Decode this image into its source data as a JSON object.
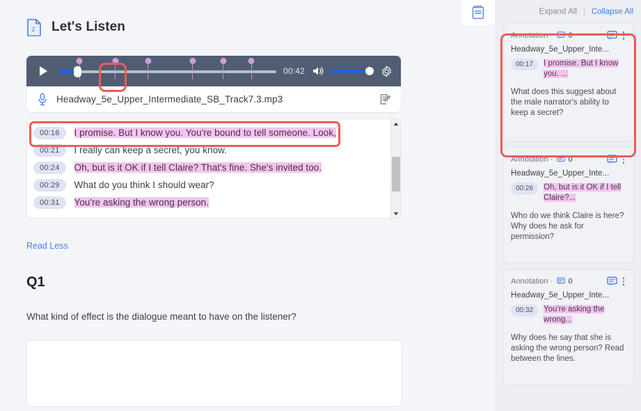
{
  "section": {
    "title": "Let's Listen",
    "doc_badge": "2"
  },
  "player": {
    "play_label": "play",
    "current_time_display": "00:42",
    "progress_percent": 8.5,
    "volume_percent": 100,
    "markers_percent": [
      9.5,
      26.0,
      41.0,
      61.5,
      75.5,
      88.5
    ],
    "file_name": "Headway_5e_Upper_Intermediate_SB_Track7.3.mp3",
    "icons": {
      "play": "play-icon",
      "volume": "volume-icon",
      "settings": "gear-icon",
      "microphone": "microphone-icon",
      "edit": "edit-note-icon"
    }
  },
  "transcript": {
    "lines": [
      {
        "time": "00:16",
        "text": "I promise. But I know you. You're bound to tell someone. Look,",
        "highlighted": true
      },
      {
        "time": "00:21",
        "text": "I really can keep a secret, you know.",
        "highlighted": false
      },
      {
        "time": "00:24",
        "text": "Oh, but is it OK if I tell Claire? That's fine. She's invited too.",
        "highlighted": true
      },
      {
        "time": "00:29",
        "text": "What do you think I should wear?",
        "highlighted": false
      },
      {
        "time": "00:31",
        "text": "You're asking the wrong person.",
        "highlighted": true
      }
    ]
  },
  "read_toggle": {
    "label": "Read Less"
  },
  "question": {
    "number": "Q1",
    "prompt": "What kind of effect is the dialogue meant to have on the listener?",
    "answer_value": "",
    "answer_placeholder": ""
  },
  "annotations_panel": {
    "tab_icon": "notebook-icon",
    "expand_all": "Expand All",
    "divider": "|",
    "collapse_all": "Collapse All",
    "cards": [
      {
        "label": "Annotation ·",
        "comment_count": "0",
        "file": "Headway_5e_Upper_Inte...",
        "time": "00:17",
        "quote": "I promise. But I know you. ...",
        "note": "What does this suggest about the male narrator's ability to keep a secret?"
      },
      {
        "label": "Annotation ·",
        "comment_count": "0",
        "file": "Headway_5e_Upper_Inte...",
        "time": "00:26",
        "quote": "Oh, but is it OK if I tell Claire?...",
        "note": "Who do we think Claire is here? Why does he ask for permission?"
      },
      {
        "label": "Annotation ·",
        "comment_count": "0",
        "file": "Headway_5e_Upper_Inte...",
        "time": "00:32",
        "quote": "You're asking the wrong...",
        "note": "Why does he say that she is asking the wrong person? Read between the lines."
      }
    ]
  },
  "colors": {
    "page_bg": "#f4f5f8",
    "player_bg": "#505d73",
    "accent_blue": "#1565f0",
    "link_blue": "#4a7fe0",
    "highlight_pink": "#f3c4ef",
    "timestamp_chip": "#dfe3f3",
    "marker_pink": "#cf9ed6",
    "annotation_outline": "#ee5b54",
    "panel_bg": "#eceef3"
  }
}
